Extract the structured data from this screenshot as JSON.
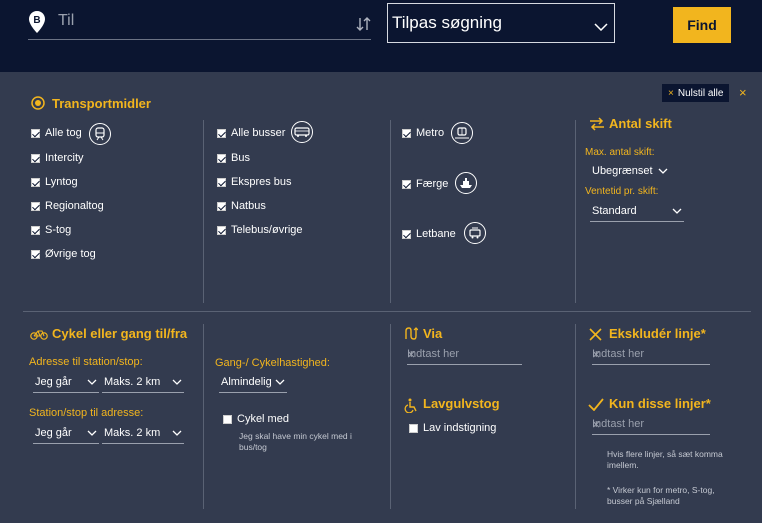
{
  "search": {
    "to_placeholder": "Til",
    "to_marker": "B",
    "customize_label": "Tilpas søgning",
    "find_label": "Find"
  },
  "panel": {
    "reset_label": "Nulstil alle",
    "reset_x": "×",
    "close_x": "×"
  },
  "transport": {
    "title": "Transportmidler",
    "col1": [
      {
        "label": "Alle tog",
        "checked": true
      },
      {
        "label": "Intercity",
        "checked": true
      },
      {
        "label": "Lyntog",
        "checked": true
      },
      {
        "label": "Regionaltog",
        "checked": true
      },
      {
        "label": "S-tog",
        "checked": true
      },
      {
        "label": "Øvrige tog",
        "checked": true
      }
    ],
    "col2": [
      {
        "label": "Alle busser",
        "checked": true
      },
      {
        "label": "Bus",
        "checked": true
      },
      {
        "label": "Ekspres bus",
        "checked": true
      },
      {
        "label": "Natbus",
        "checked": true
      },
      {
        "label": "Telebus/øvrige",
        "checked": true
      }
    ],
    "col3": [
      {
        "label": "Metro",
        "checked": true
      },
      {
        "label": "Færge",
        "checked": true
      },
      {
        "label": "Letbane",
        "checked": true
      }
    ]
  },
  "transfers": {
    "title": "Antal skift",
    "max_label": "Max. antal skift:",
    "max_value": "Ubegrænset",
    "wait_label": "Ventetid pr. skift:",
    "wait_value": "Standard"
  },
  "bike_walk": {
    "title": "Cykel eller gang til/fra",
    "to_station_label": "Adresse til station/stop:",
    "to_station_mode": "Jeg går",
    "to_station_max": "Maks. 2 km",
    "from_station_label": "Station/stop til adresse:",
    "from_station_mode": "Jeg går",
    "from_station_max": "Maks. 2 km",
    "speed_label": "Gang-/ Cykelhastighed:",
    "speed_value": "Almindelig",
    "bike_with_label": "Cykel med",
    "bike_with_checked": false,
    "bike_with_hint": "Jeg skal have min cykel med i bus/tog"
  },
  "via": {
    "title": "Via",
    "placeholder": "Indtast her",
    "clear": "×"
  },
  "low_floor": {
    "title": "Lavgulvstog",
    "checkbox_label": "Lav indstigning",
    "checked": false
  },
  "exclude": {
    "title": "Ekskludér linje*",
    "placeholder": "Indtast her",
    "clear": "×"
  },
  "only": {
    "title": "Kun disse linjer*",
    "placeholder": "Indtast her",
    "clear": "×",
    "hint1": "Hvis flere linjer, så sæt komma imellem.",
    "hint2": "* Virker kun for metro, S-tog, busser på Sjælland"
  },
  "colors": {
    "accent": "#f2b51e",
    "navy": "#0b1530",
    "panel": "#333b4f"
  }
}
